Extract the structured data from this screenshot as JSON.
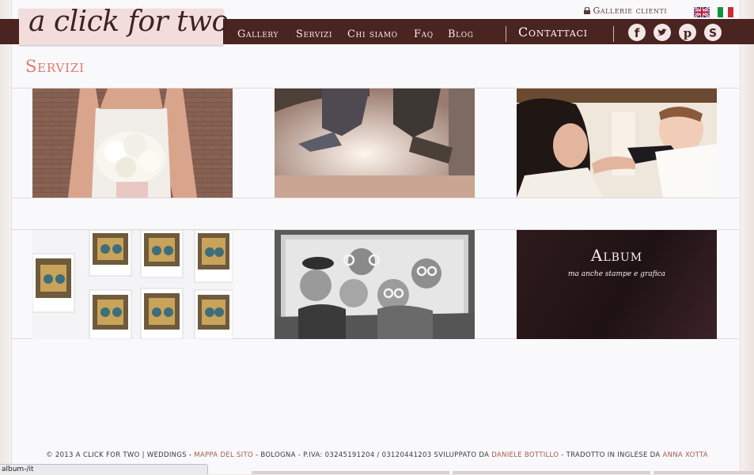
{
  "logo": {
    "text": "a click for two"
  },
  "topbar": {
    "client_galleries": "Gallerie clienti"
  },
  "languages": [
    {
      "name": "English",
      "icon": "uk-flag-icon"
    },
    {
      "name": "Italiano",
      "icon": "italy-flag-icon"
    }
  ],
  "nav": {
    "items": [
      "Gallery",
      "Servizi",
      "Chi siamo",
      "Faq",
      "Blog"
    ],
    "contact": "Contattaci"
  },
  "social": [
    "facebook-icon",
    "twitter-icon",
    "pinterest-icon",
    "skype-icon"
  ],
  "page": {
    "title": "Servizi"
  },
  "services": [
    {
      "photo": "bride holding white bouquet"
    },
    {
      "photo": "couple jumping"
    },
    {
      "photo": "mother with baby"
    },
    {
      "photo": "polaroid photobooth prints"
    },
    {
      "photo": "friends with photobooth props in frame"
    },
    {
      "title": "Album",
      "subtitle": "ma anche stampe e grafica"
    }
  ],
  "footer": {
    "prefix": "© 2013 A CLICK FOR TWO | WEDDINGS - ",
    "sitemap": "MAPPA DEL SITO",
    "middle": " - BOLOGNA - P.IVA: 03245191204 / 03120441203 SVILUPPATO DA ",
    "developer": "DANIELE BOTTILLO",
    "translated": " - TRADOTTO IN INGLESE DA ",
    "translator": "ANNA XOTTA"
  },
  "status_bar": {
    "url": "album-/it"
  },
  "colors": {
    "nav_bg": "#4a2420",
    "accent": "#e6766b",
    "logo_bg": "#f3dcdc"
  }
}
